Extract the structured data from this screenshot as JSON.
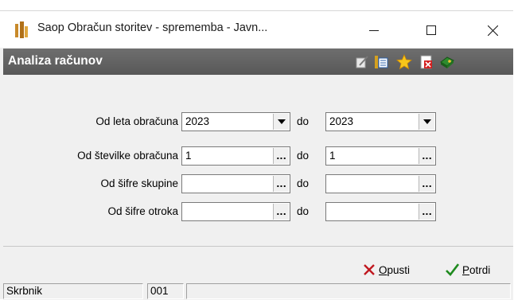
{
  "window": {
    "title": "Saop Obračun storitev - sprememba - Javn...",
    "controls": {
      "minimize": "—",
      "maximize": "☐",
      "close": "✕"
    }
  },
  "header": {
    "title": "Analiza računov",
    "icons": [
      "edit-icon",
      "list-icon",
      "star-icon",
      "delete-icon",
      "book-icon"
    ]
  },
  "form": {
    "rows": [
      {
        "label": "Od leta obračuna",
        "from": "2023",
        "to": "2023",
        "type": "dropdown"
      },
      {
        "label": "Od številke obračuna",
        "from": "1",
        "to": "1",
        "type": "picker"
      },
      {
        "label": "Od šifre skupine",
        "from": "",
        "to": "",
        "type": "picker"
      },
      {
        "label": "Od šifre otroka",
        "from": "",
        "to": "",
        "type": "picker"
      }
    ],
    "to_label": "do",
    "picker_glyph": "..."
  },
  "footer": {
    "cancel_label": "Opusti",
    "cancel_accel": "O",
    "cancel_rest": "pusti",
    "confirm_label": "Potrdi",
    "confirm_accel": "P",
    "confirm_rest": "otrdi"
  },
  "status": {
    "user": "Skrbnik",
    "code": "001",
    "message": ""
  },
  "colors": {
    "header_bg": "#606060",
    "cancel_icon": "#c0181f",
    "confirm_icon": "#1e8a1e"
  }
}
